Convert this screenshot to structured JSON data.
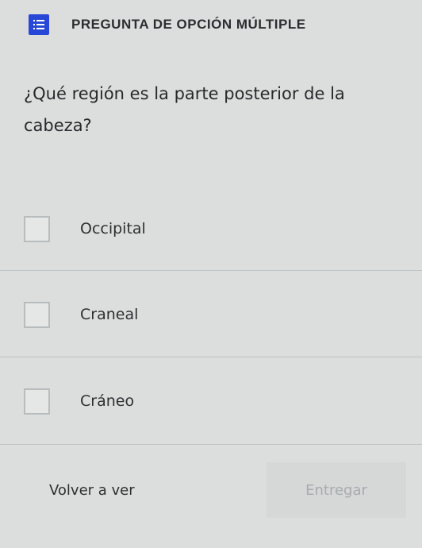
{
  "header": {
    "icon": "list-numbered-icon",
    "icon_color": "#2747d6",
    "title": "PREGUNTA DE OPCIÓN MÚLTIPLE"
  },
  "question": {
    "text": "¿Qué región es la parte posterior de la cabeza?"
  },
  "options": [
    {
      "label": "Occipital",
      "checked": false
    },
    {
      "label": "Craneal",
      "checked": false
    },
    {
      "label": "Cráneo",
      "checked": false
    }
  ],
  "footer": {
    "review_label": "Volver a ver",
    "submit_label": "Entregar",
    "submit_enabled": false
  }
}
